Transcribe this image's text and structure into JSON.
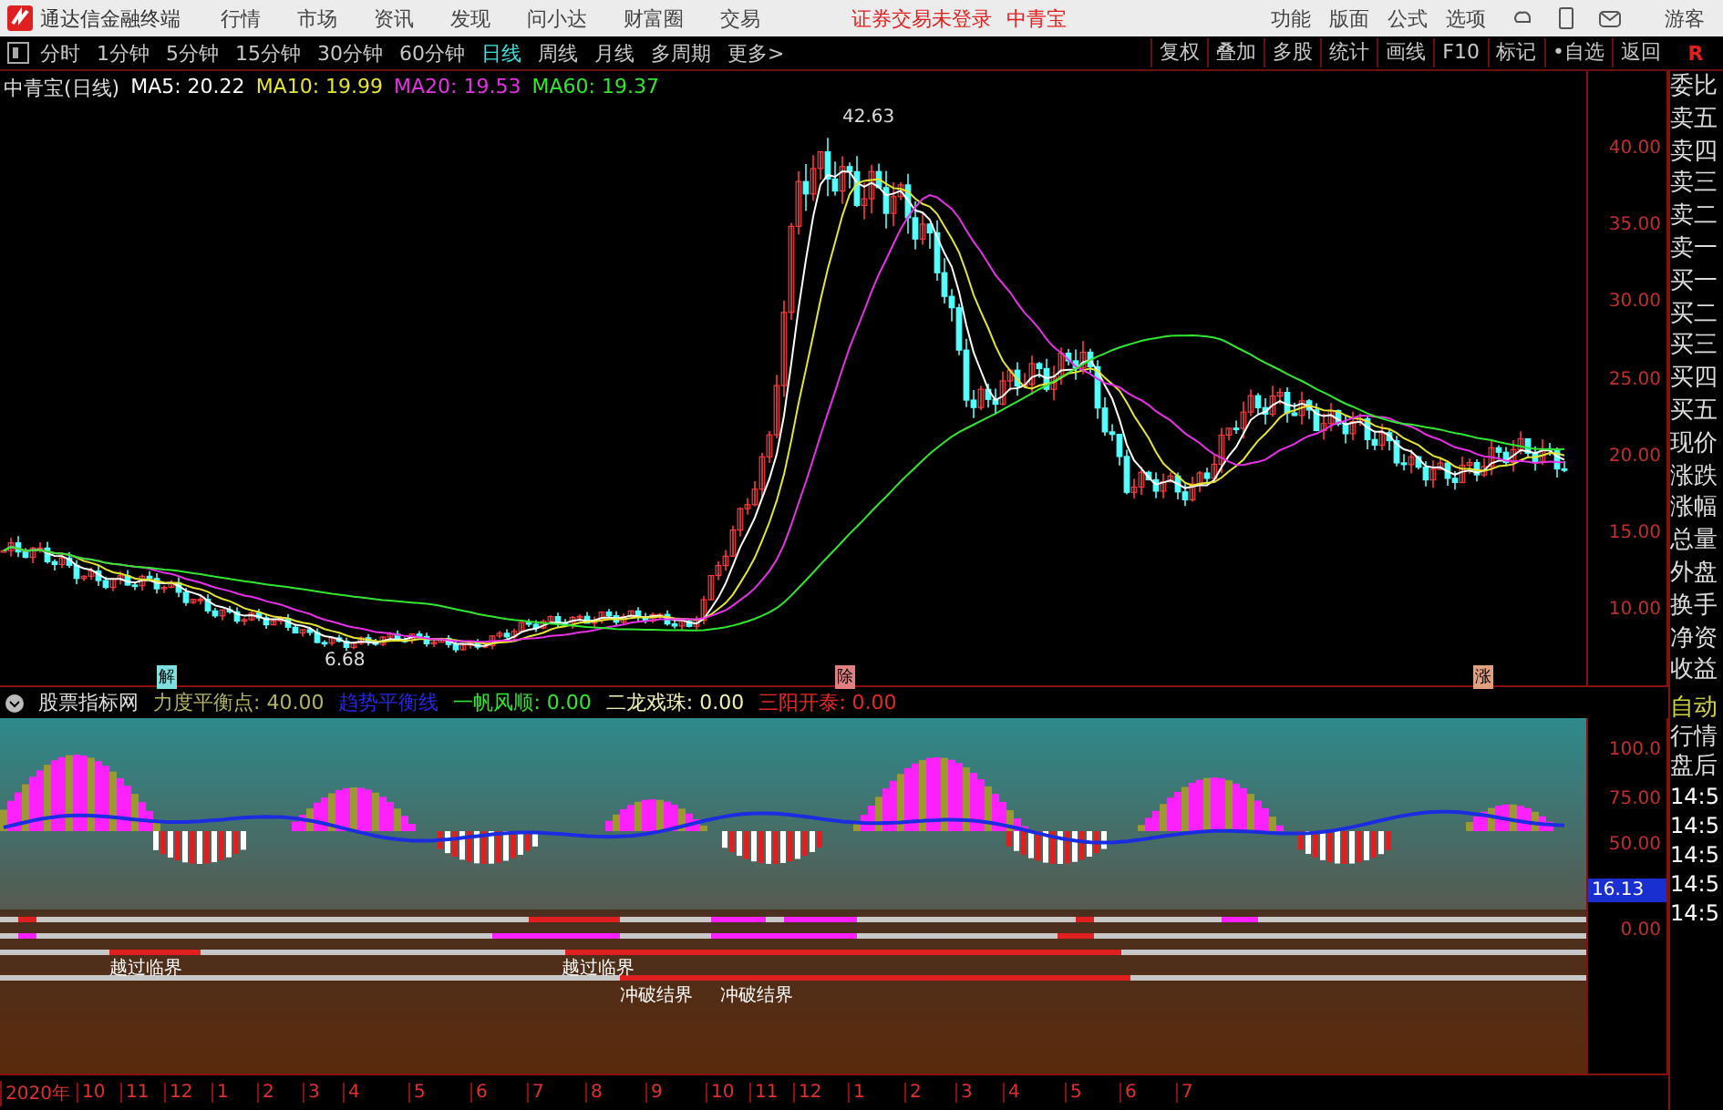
{
  "menu_bar": {
    "app_name": "通达信金融终端",
    "menus": [
      "行情",
      "市场",
      "资讯",
      "发现",
      "问小达",
      "财富圈",
      "交易"
    ],
    "notice": "证券交易未登录",
    "stock": "中青宝",
    "right_menus": [
      "功能",
      "版面",
      "公式",
      "选项"
    ],
    "user": "游客"
  },
  "period_bar": {
    "periods": [
      {
        "label": "分时",
        "selected": false
      },
      {
        "label": "1分钟",
        "selected": false
      },
      {
        "label": "5分钟",
        "selected": false
      },
      {
        "label": "15分钟",
        "selected": false
      },
      {
        "label": "30分钟",
        "selected": false
      },
      {
        "label": "60分钟",
        "selected": false
      },
      {
        "label": "日线",
        "selected": true
      },
      {
        "label": "周线",
        "selected": false
      },
      {
        "label": "月线",
        "selected": false
      },
      {
        "label": "多周期",
        "selected": false
      },
      {
        "label": "更多>",
        "selected": false
      }
    ],
    "tools": [
      "复权",
      "叠加",
      "多股",
      "统计",
      "画线",
      "F10",
      "标记",
      "•自选",
      "返回"
    ],
    "side_tab": "R"
  },
  "main_chart": {
    "title": "中青宝(日线)",
    "ma": [
      {
        "label": "MA5: 20.22",
        "color": "#ffffff"
      },
      {
        "label": "MA10: 19.99",
        "color": "#e6e632"
      },
      {
        "label": "MA20: 19.53",
        "color": "#e632e6"
      },
      {
        "label": "MA60: 19.37",
        "color": "#32e632"
      }
    ],
    "y_labels": [
      "40.00",
      "35.00",
      "30.00",
      "25.00",
      "20.00",
      "15.00",
      "10.00"
    ],
    "high_label": "42.63",
    "low_label": "6.68",
    "event_marks": [
      "解",
      "除",
      "涨"
    ]
  },
  "indicator": {
    "name": "股票指标网",
    "values": [
      {
        "label": "力度平衡点: 40.00",
        "color": "#b4b464"
      },
      {
        "label": "趋势平衡线",
        "color": "#2828e6"
      },
      {
        "label": "一帆风顺: 0.00",
        "color": "#32e632"
      },
      {
        "label": "二龙戏珠: 0.00",
        "color": "#f0f0b4"
      },
      {
        "label": "三阳开泰: 0.00",
        "color": "#e62828"
      }
    ],
    "y_labels": [
      "100.0",
      "75.00",
      "50.00",
      "0.00"
    ],
    "current": "16.13",
    "signals": [
      "越过临界",
      "越过临界",
      "冲破结界",
      "冲破结界"
    ]
  },
  "date_axis": [
    "2020年",
    "10",
    "11",
    "12",
    "1",
    "2",
    "3",
    "4",
    "5",
    "6",
    "7",
    "8",
    "9",
    "10",
    "11",
    "12",
    "1",
    "2",
    "3",
    "4",
    "5",
    "6",
    "7"
  ],
  "side_panel": {
    "quote_labels": [
      "委比",
      "卖五",
      "卖四",
      "卖三",
      "卖二",
      "卖一",
      "买一",
      "买二",
      "买三",
      "买四",
      "买五",
      "现价",
      "涨跌",
      "涨幅",
      "总量",
      "外盘",
      "换手",
      "净资",
      "收益"
    ],
    "modes": [
      "自动",
      "行情",
      "盘后"
    ],
    "times": [
      "14:5",
      "14:5",
      "14:5",
      "14:5",
      "14:5"
    ]
  }
}
